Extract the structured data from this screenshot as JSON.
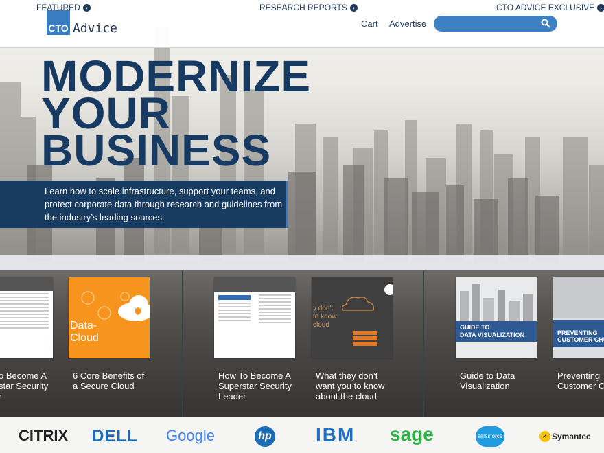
{
  "header": {
    "logo_mark": "CTO",
    "logo_text": "Advice",
    "nav": [
      "Cart",
      "Advertise"
    ],
    "search_placeholder": ""
  },
  "hero": {
    "headline": [
      "MODERNIZE",
      "YOUR",
      "BUSINESS"
    ],
    "intro": "Learn how to scale infrastructure, support your teams, and protect corporate data through research and guidelines from the industry’s leading sources."
  },
  "sections": [
    {
      "label": "FEATURED"
    },
    {
      "label": "RESEARCH REPORTS"
    },
    {
      "label": "CTO ADVICE EXCLUSIVE"
    }
  ],
  "cards": [
    {
      "caption": "o Become A\nstar Security\nr",
      "thumb_title": ""
    },
    {
      "caption": "6 Core Benefits of\na Secure Cloud",
      "thumb_title": "Data-\nCloud"
    },
    {
      "caption": "How To Become A\nSuperstar Security\nLeader",
      "thumb_title": ""
    },
    {
      "caption": "What they don’t\nwant you to know\nabout the cloud",
      "thumb_title": "y don't\nto know\ncloud"
    },
    {
      "caption": "Guide to Data\nVisualization",
      "thumb_title": "GUIDE TO\nDATA VISUALIZATION"
    },
    {
      "caption": "Preventing\nCustomer C",
      "thumb_title": "PREVENTING\nCUSTOMER CHU"
    }
  ],
  "brands": [
    "CITRIX",
    "DELL",
    "Google",
    "hp",
    "IBM",
    "sage",
    "salesforce",
    "Symantec"
  ],
  "colors": {
    "navy": "#173a63",
    "accent": "#3a7dc0",
    "orange": "#f7941d"
  }
}
